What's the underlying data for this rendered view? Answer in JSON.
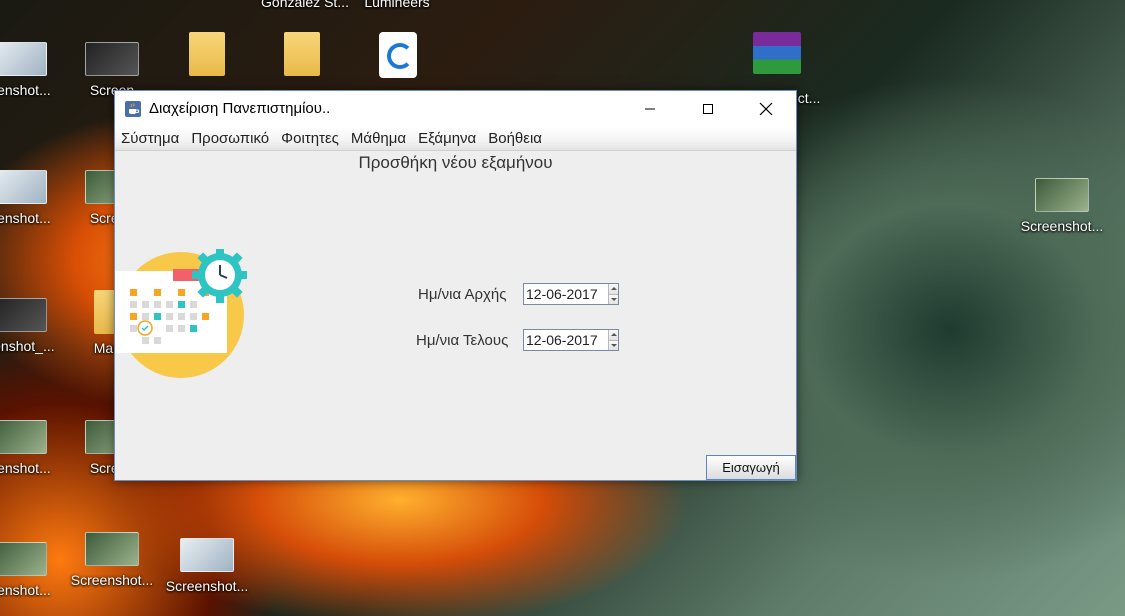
{
  "desktop": {
    "top_labels": [
      "Gonzalez St...",
      "Luminéers"
    ],
    "icons_left": [
      {
        "label": "eenshot...",
        "thumb": "shot",
        "icon": "screenshot-icon"
      },
      {
        "label": "Screen",
        "thumb": "dark",
        "icon": "screenshot-icon"
      },
      {
        "label": "eenshot...",
        "thumb": "shot",
        "icon": "screenshot-icon"
      },
      {
        "label": "Screen",
        "thumb": "green",
        "icon": "screenshot-icon"
      },
      {
        "label": "eenshot_...",
        "thumb": "dark",
        "icon": "screenshot-icon"
      },
      {
        "label": "ManP",
        "thumb": "folder",
        "icon": "folder-icon"
      },
      {
        "label": "eenshot...",
        "thumb": "green",
        "icon": "screenshot-icon"
      },
      {
        "label": "Screen",
        "thumb": "green",
        "icon": "screenshot-icon"
      },
      {
        "label": "eenshot...",
        "thumb": "green",
        "icon": "screenshot-icon"
      },
      {
        "label": "Screenshot...",
        "thumb": "green",
        "icon": "screenshot-icon"
      },
      {
        "label": "Screenshot...",
        "thumb": "shot",
        "icon": "screenshot-icon"
      }
    ],
    "right_icon_label": "Screenshot...",
    "partial_label": "ect..."
  },
  "window": {
    "title": "Διαχείριση Πανεπιστημίου..",
    "icon": "java-cup-icon",
    "controls": {
      "minimize": "minimize-icon",
      "maximize": "maximize-icon",
      "close": "close-icon"
    }
  },
  "menu": [
    "Σύστημα",
    "Προσωπικό",
    "Φοιτητες",
    "Μάθημα",
    "Εξάμηνα",
    "Βοήθεια"
  ],
  "form": {
    "heading": "Προσθήκη νέου εξαμήνου",
    "start_label": "Ημ/νια Αρχής",
    "start_value": "12-06-2017",
    "end_label": "Ημ/νια Τελους",
    "end_value": "12-06-2017",
    "submit_label": "Εισαγωγή"
  },
  "colors": {
    "window_bg": "#eeeeee",
    "accent_border": "#5b86c5",
    "calendar_circle": "#f8c849",
    "gear": "#2ec4c4"
  }
}
